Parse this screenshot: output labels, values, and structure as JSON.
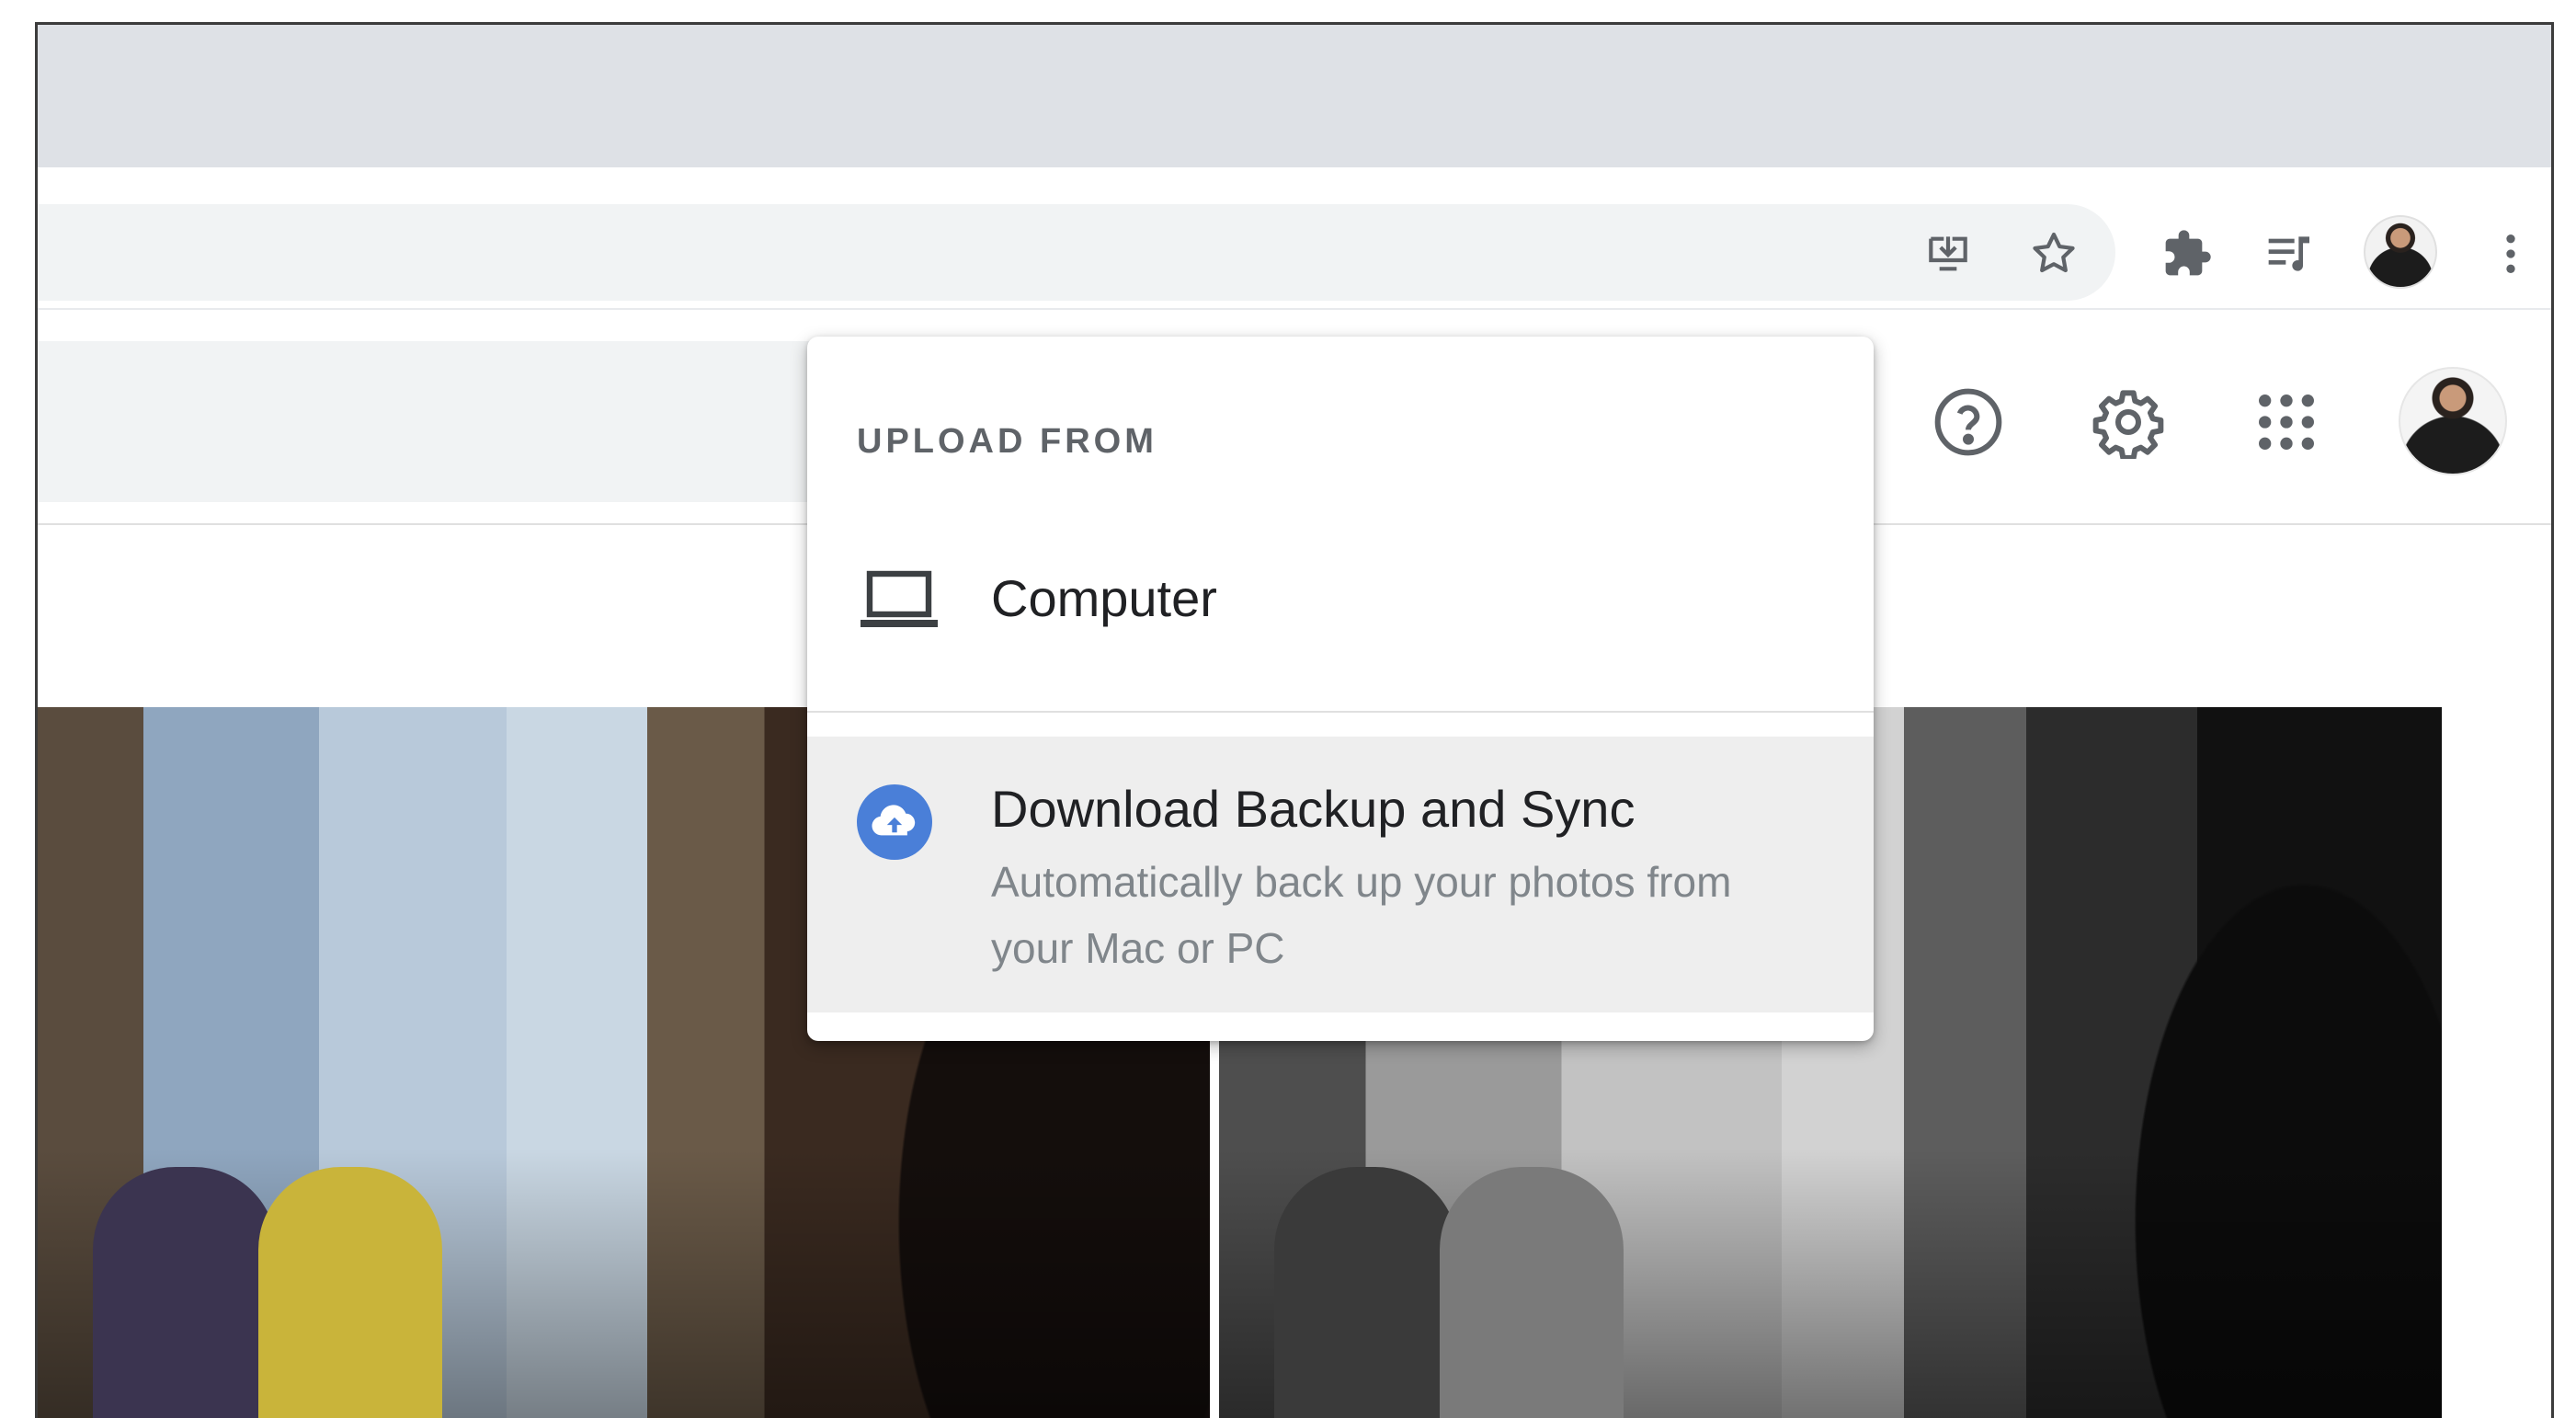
{
  "menu": {
    "heading": "UPLOAD FROM",
    "items": [
      {
        "label": "Computer",
        "icon": "laptop-icon"
      },
      {
        "label": "Download Backup and Sync",
        "description": "Automatically back up your photos from your Mac or PC",
        "icon": "cloud-upload-icon"
      }
    ]
  },
  "browser_toolbar": {
    "icons": [
      "install-app-icon",
      "bookmark-star-icon",
      "extensions-icon",
      "media-controls-icon",
      "profile-avatar",
      "more-vert-icon"
    ]
  },
  "app_header": {
    "icons": [
      "help-icon",
      "settings-gear-icon",
      "apps-grid-icon",
      "account-avatar"
    ]
  },
  "colors": {
    "accent": "#4285f4",
    "menu_highlight": "#eeeeee",
    "icon_gray": "#5f6368"
  }
}
